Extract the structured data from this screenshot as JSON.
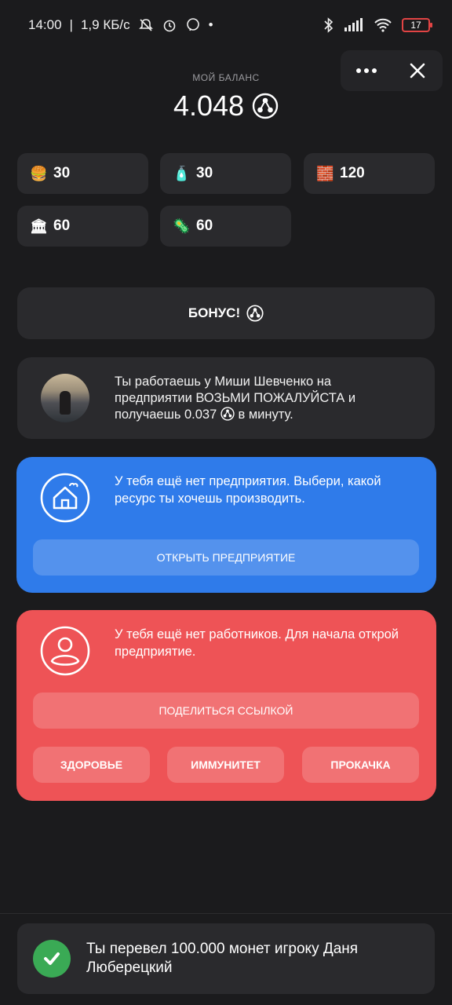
{
  "status_bar": {
    "time": "14:00",
    "speed": "1,9 КБ/с",
    "battery": "17"
  },
  "balance": {
    "label": "МОЙ БАЛАНС",
    "value": "4.048"
  },
  "resources": [
    {
      "icon": "burger-icon",
      "emoji": "🍔",
      "value": "30"
    },
    {
      "icon": "pill-icon",
      "emoji": "🧴",
      "value": "30"
    },
    {
      "icon": "brick-icon",
      "emoji": "🧱",
      "value": "120"
    },
    {
      "icon": "bank-icon",
      "emoji": "🏛",
      "value": "60"
    },
    {
      "icon": "virus-icon",
      "emoji": "🦠",
      "value": "60"
    }
  ],
  "bonus_label": "БОНУС!",
  "work": {
    "line1": "Ты работаешь у Миши Шевченко на",
    "line2": "предприятии ВОЗЬМИ ПОЖАЛУЙСТА и",
    "line3_pre": "получаешь 0.037",
    "line3_post": "в минуту."
  },
  "enterprise": {
    "text": "У тебя ещё нет предприятия. Выбери, какой ресурс ты хочешь производить.",
    "button": "ОТКРЫТЬ ПРЕДПРИЯТИЕ"
  },
  "workers": {
    "text": "У тебя ещё нет работников. Для начала открой предприятие.",
    "share_button": "ПОДЕЛИТЬСЯ ССЫЛКОЙ",
    "buttons": [
      "ЗДОРОВЬЕ",
      "ИММУНИТЕТ",
      "ПРОКАЧКА"
    ]
  },
  "toast": {
    "text": "Ты перевел 100.000 монет игроку Даня Люберецкий"
  },
  "colors": {
    "background": "#1b1b1d",
    "card": "#2a2a2d",
    "blue": "#2f7bea",
    "red": "#ee5356",
    "success": "#3aaa55"
  }
}
